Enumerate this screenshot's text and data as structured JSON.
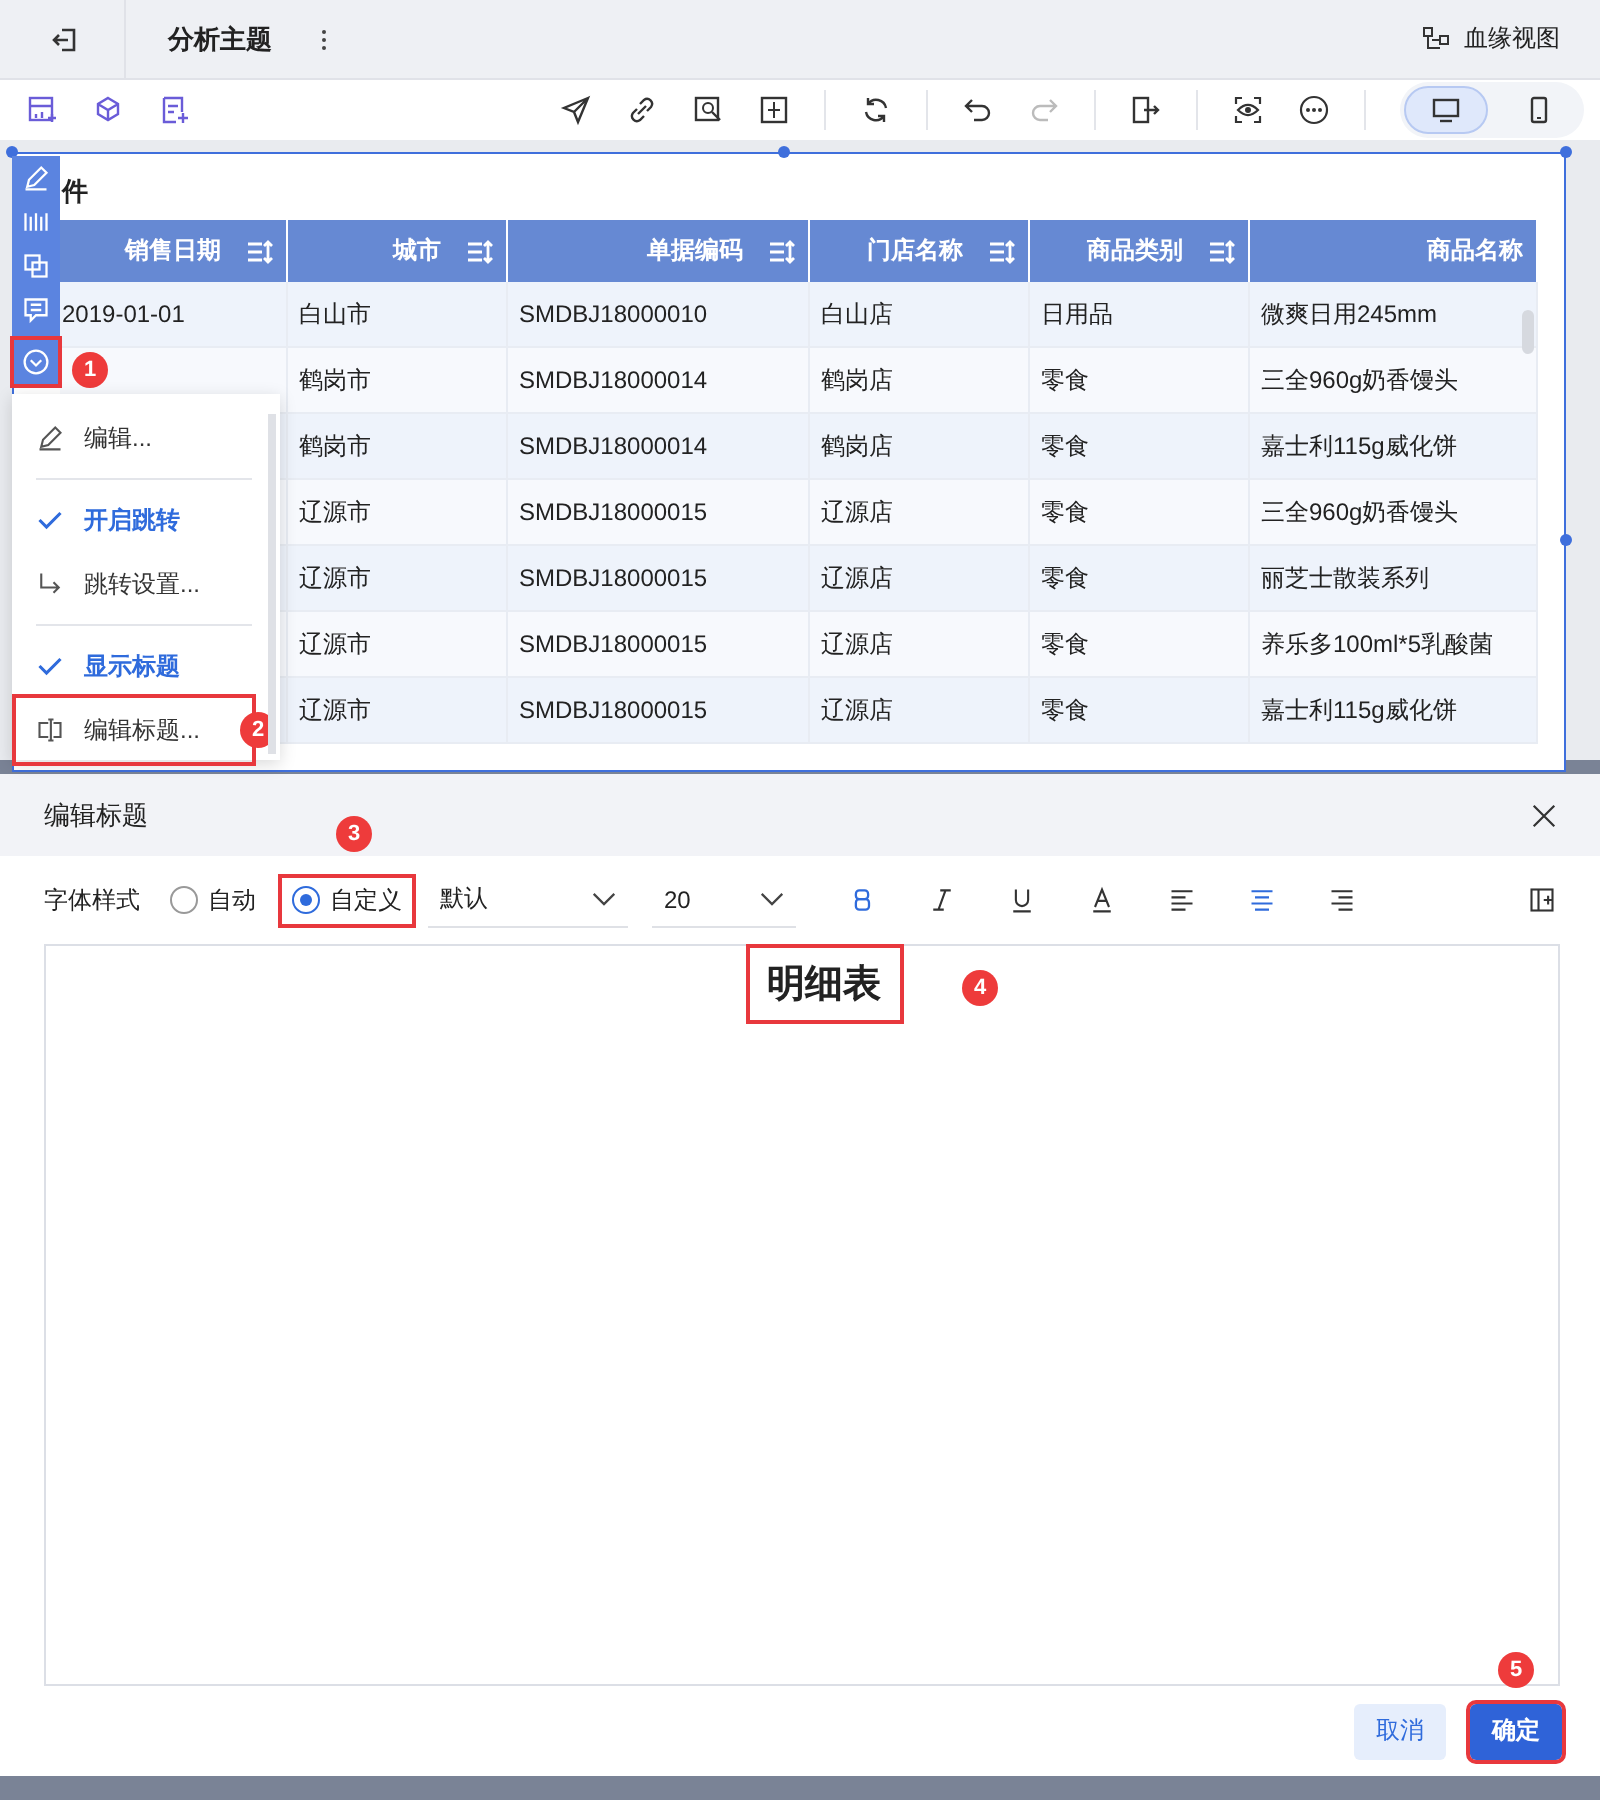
{
  "top_bar": {
    "title": "分析主题",
    "lineage_label": "血缘视图"
  },
  "device_toggle": [
    {
      "kind": "desktop",
      "selected": true
    },
    {
      "kind": "mobile",
      "selected": false
    }
  ],
  "component": {
    "title": "件",
    "toolbar_callout": "1",
    "columns": [
      {
        "label": "销售日期",
        "sortable": true
      },
      {
        "label": "城市",
        "sortable": true
      },
      {
        "label": "单据编码",
        "sortable": true
      },
      {
        "label": "门店名称",
        "sortable": true
      },
      {
        "label": "商品类别",
        "sortable": true
      },
      {
        "label": "商品名称",
        "sortable": false
      }
    ],
    "rows": [
      {
        "cells": [
          "2019-01-01",
          "白山市",
          "SMDBJ18000010",
          "白山店",
          "日用品",
          "微爽日用245mm"
        ]
      },
      {
        "cells": [
          "",
          "鹤岗市",
          "SMDBJ18000014",
          "鹤岗店",
          "零食",
          "三全960g奶香馒头"
        ]
      },
      {
        "cells": [
          "",
          "鹤岗市",
          "SMDBJ18000014",
          "鹤岗店",
          "零食",
          "嘉士利115g威化饼"
        ]
      },
      {
        "cells": [
          "",
          "辽源市",
          "SMDBJ18000015",
          "辽源店",
          "零食",
          "三全960g奶香馒头"
        ]
      },
      {
        "cells": [
          "",
          "辽源市",
          "SMDBJ18000015",
          "辽源店",
          "零食",
          "丽芝士散装系列"
        ]
      },
      {
        "cells": [
          "",
          "辽源市",
          "SMDBJ18000015",
          "辽源店",
          "零食",
          "养乐多100ml*5乳酸菌"
        ]
      },
      {
        "cells": [
          "",
          "辽源市",
          "SMDBJ18000015",
          "辽源店",
          "零食",
          "嘉士利115g威化饼"
        ]
      }
    ]
  },
  "context_menu": [
    {
      "kind": "edit",
      "label": "编辑..."
    },
    {
      "kind": "separator"
    },
    {
      "kind": "toggle",
      "label": "开启跳转",
      "checked": true
    },
    {
      "kind": "link",
      "label": "跳转设置..."
    },
    {
      "kind": "separator"
    },
    {
      "kind": "toggle",
      "label": "显示标题",
      "checked": true
    },
    {
      "kind": "title",
      "label": "编辑标题...",
      "callout": "2"
    }
  ],
  "dialog": {
    "title": "编辑标题",
    "font_style_label": "字体样式",
    "radios": [
      {
        "label": "自动",
        "selected": false
      },
      {
        "label": "自定义",
        "selected": true,
        "callout": "3"
      }
    ],
    "font_select": "默认",
    "size_select": "20",
    "format_buttons": [
      {
        "kind": "bold",
        "selected": true
      },
      {
        "kind": "italic",
        "selected": false
      },
      {
        "kind": "underline",
        "selected": false
      },
      {
        "kind": "color",
        "selected": false
      },
      {
        "kind": "align-left",
        "selected": false
      },
      {
        "kind": "align-center",
        "selected": true
      },
      {
        "kind": "align-right",
        "selected": false
      }
    ],
    "preview_text": "明细表",
    "preview_callout": "4",
    "cancel": "取消",
    "confirm": "确定",
    "confirm_callout": "5"
  }
}
